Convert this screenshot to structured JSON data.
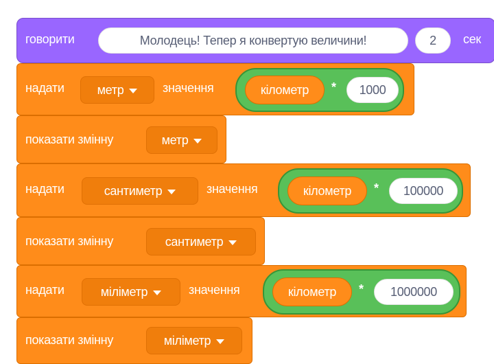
{
  "blocks": [
    {
      "type": "say",
      "label": "говорити",
      "message": "Молодець! Тепер я конвертую величини!",
      "seconds": "2",
      "unit": "сек"
    },
    {
      "type": "set",
      "label": "надати",
      "variable": "метр",
      "to_label": "значення",
      "reporter": "кілометр",
      "operator": "*",
      "value": "1000"
    },
    {
      "type": "show",
      "label": "показати змінну",
      "variable": "метр"
    },
    {
      "type": "set",
      "label": "надати",
      "variable": "сантиметр",
      "to_label": "значення",
      "reporter": "кілометр",
      "operator": "*",
      "value": "100000"
    },
    {
      "type": "show",
      "label": "показати змінну",
      "variable": "сантиметр"
    },
    {
      "type": "set",
      "label": "надати",
      "variable": "міліметр",
      "to_label": "значення",
      "reporter": "кілометр",
      "operator": "*",
      "value": "1000000"
    },
    {
      "type": "show",
      "label": "показати змінну",
      "variable": "міліметр"
    }
  ],
  "colors": {
    "looks": "#9966FF",
    "variables": "#FF8C1A",
    "operators": "#59C059",
    "input_text": "#575E75"
  },
  "icons": {
    "dropdown": "dropdown-arrow-icon"
  }
}
